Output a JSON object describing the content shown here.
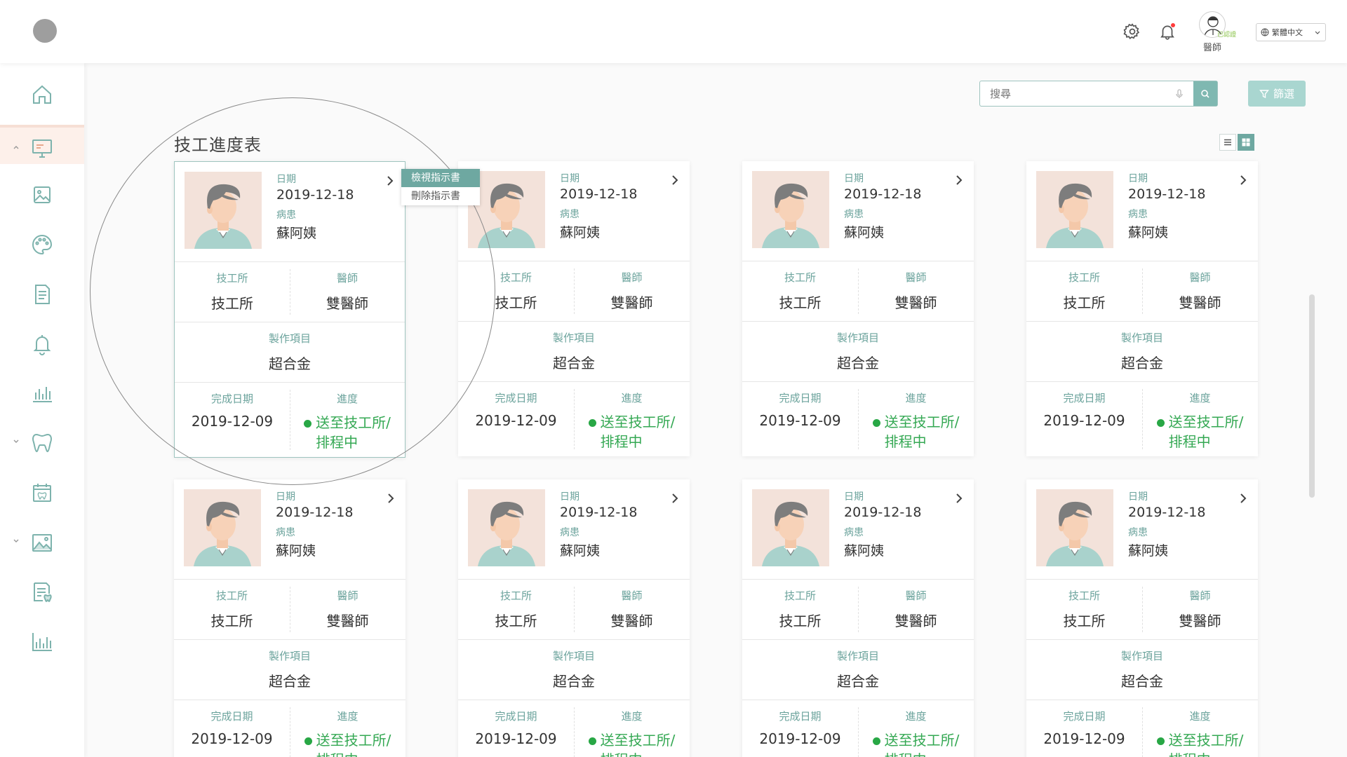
{
  "header": {
    "doctor_verified": "已認證",
    "doctor_role": "醫師",
    "language": "繁體中文"
  },
  "sidebar": {
    "items": [
      {
        "icon": "home-icon"
      },
      {
        "icon": "monitor-icon",
        "active": true,
        "expanded": true
      },
      {
        "icon": "image-icon"
      },
      {
        "icon": "palette-icon"
      },
      {
        "icon": "document-icon"
      },
      {
        "icon": "bell-icon"
      },
      {
        "icon": "bar-chart-icon"
      },
      {
        "icon": "tooth-icon",
        "collapsible": true
      },
      {
        "icon": "calendar-tooth-icon"
      },
      {
        "icon": "gallery-icon",
        "collapsible": true
      },
      {
        "icon": "report-tooth-icon"
      },
      {
        "icon": "analytics-icon"
      }
    ]
  },
  "toolbar": {
    "search_placeholder": "搜尋",
    "filter_label": "篩選"
  },
  "page": {
    "title": "技工進度表"
  },
  "context_menu": {
    "items": [
      "檢視指示書",
      "刪除指示書"
    ]
  },
  "labels": {
    "date": "日期",
    "patient": "病患",
    "lab": "技工所",
    "doctor": "醫師",
    "item": "製作項目",
    "done_date": "完成日期",
    "progress": "進度"
  },
  "cards": [
    {
      "date": "2019-12-18",
      "patient": "蘇阿姨",
      "lab": "技工所",
      "doctor": "雙醫師",
      "item": "超合金",
      "done_date": "2019-12-09",
      "progress_line1": "送至技工所/",
      "progress_line2": "排程中"
    },
    {
      "date": "2019-12-18",
      "patient": "蘇阿姨",
      "lab": "技工所",
      "doctor": "雙醫師",
      "item": "超合金",
      "done_date": "2019-12-09",
      "progress_line1": "送至技工所/",
      "progress_line2": "排程中"
    },
    {
      "date": "2019-12-18",
      "patient": "蘇阿姨",
      "lab": "技工所",
      "doctor": "雙醫師",
      "item": "超合金",
      "done_date": "2019-12-09",
      "progress_line1": "送至技工所/",
      "progress_line2": "排程中"
    },
    {
      "date": "2019-12-18",
      "patient": "蘇阿姨",
      "lab": "技工所",
      "doctor": "雙醫師",
      "item": "超合金",
      "done_date": "2019-12-09",
      "progress_line1": "送至技工所/",
      "progress_line2": "排程中"
    },
    {
      "date": "2019-12-18",
      "patient": "蘇阿姨",
      "lab": "技工所",
      "doctor": "雙醫師",
      "item": "超合金",
      "done_date": "2019-12-09",
      "progress_line1": "送至技工所/",
      "progress_line2": "排程中"
    },
    {
      "date": "2019-12-18",
      "patient": "蘇阿姨",
      "lab": "技工所",
      "doctor": "雙醫師",
      "item": "超合金",
      "done_date": "2019-12-09",
      "progress_line1": "送至技工所/",
      "progress_line2": "排程中"
    },
    {
      "date": "2019-12-18",
      "patient": "蘇阿姨",
      "lab": "技工所",
      "doctor": "雙醫師",
      "item": "超合金",
      "done_date": "2019-12-09",
      "progress_line1": "送至技工所/",
      "progress_line2": "排程中"
    },
    {
      "date": "2019-12-18",
      "patient": "蘇阿姨",
      "lab": "技工所",
      "doctor": "雙醫師",
      "item": "超合金",
      "done_date": "2019-12-09",
      "progress_line1": "送至技工所/",
      "progress_line2": "排程中"
    }
  ],
  "colors": {
    "accent": "#6ea8a1",
    "status_green": "#34a853",
    "active_sidebar_bg": "#fdf0ea"
  }
}
